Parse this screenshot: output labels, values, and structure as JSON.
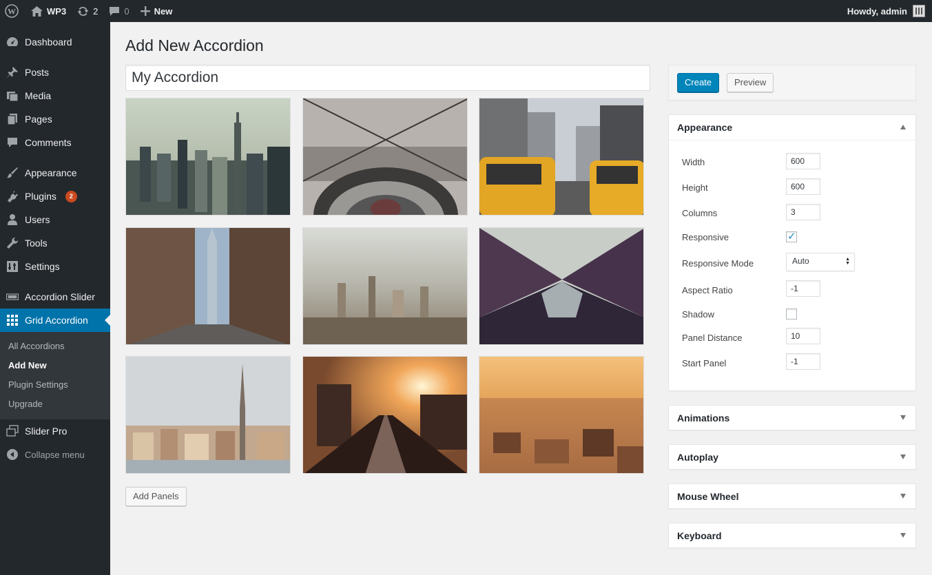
{
  "adminbar": {
    "site_name": "WP3",
    "updates_count": "2",
    "comments_count": "0",
    "new_label": "New",
    "howdy": "Howdy, admin"
  },
  "sidebar": {
    "items": [
      {
        "label": "Dashboard",
        "icon": "dashboard-icon"
      },
      {
        "label": "Posts",
        "icon": "pin-icon"
      },
      {
        "label": "Media",
        "icon": "media-icon"
      },
      {
        "label": "Pages",
        "icon": "pages-icon"
      },
      {
        "label": "Comments",
        "icon": "comment-icon"
      },
      {
        "label": "Appearance",
        "icon": "brush-icon"
      },
      {
        "label": "Plugins",
        "icon": "plugin-icon",
        "badge": "2"
      },
      {
        "label": "Users",
        "icon": "user-icon"
      },
      {
        "label": "Tools",
        "icon": "wrench-icon"
      },
      {
        "label": "Settings",
        "icon": "settings-icon"
      },
      {
        "label": "Accordion Slider",
        "icon": "slider-icon"
      },
      {
        "label": "Grid Accordion",
        "icon": "grid-icon"
      },
      {
        "label": "Slider Pro",
        "icon": "layers-icon"
      },
      {
        "label": "Collapse menu",
        "icon": "collapse-icon"
      }
    ],
    "submenu": [
      "All Accordions",
      "Add New",
      "Plugin Settings",
      "Upgrade"
    ]
  },
  "main": {
    "page_title": "Add New Accordion",
    "accordion_name": "My Accordion",
    "add_panels_label": "Add Panels"
  },
  "actions": {
    "create_label": "Create",
    "preview_label": "Preview"
  },
  "appearance": {
    "title": "Appearance",
    "settings": {
      "width": {
        "label": "Width",
        "value": "600"
      },
      "height": {
        "label": "Height",
        "value": "600"
      },
      "columns": {
        "label": "Columns",
        "value": "3"
      },
      "responsive": {
        "label": "Responsive",
        "checked": true
      },
      "responsive_mode": {
        "label": "Responsive Mode",
        "value": "Auto"
      },
      "aspect_ratio": {
        "label": "Aspect Ratio",
        "value": "-1"
      },
      "shadow": {
        "label": "Shadow",
        "checked": false
      },
      "panel_distance": {
        "label": "Panel Distance",
        "value": "10"
      },
      "start_panel": {
        "label": "Start Panel",
        "value": "-1"
      }
    }
  },
  "collapsed_sections": [
    "Animations",
    "Autoplay",
    "Mouse Wheel",
    "Keyboard"
  ],
  "colors": {
    "admin_bar": "#23282d",
    "accent": "#0073aa",
    "primary_button": "#0085ba",
    "badge": "#ca4a1f"
  }
}
